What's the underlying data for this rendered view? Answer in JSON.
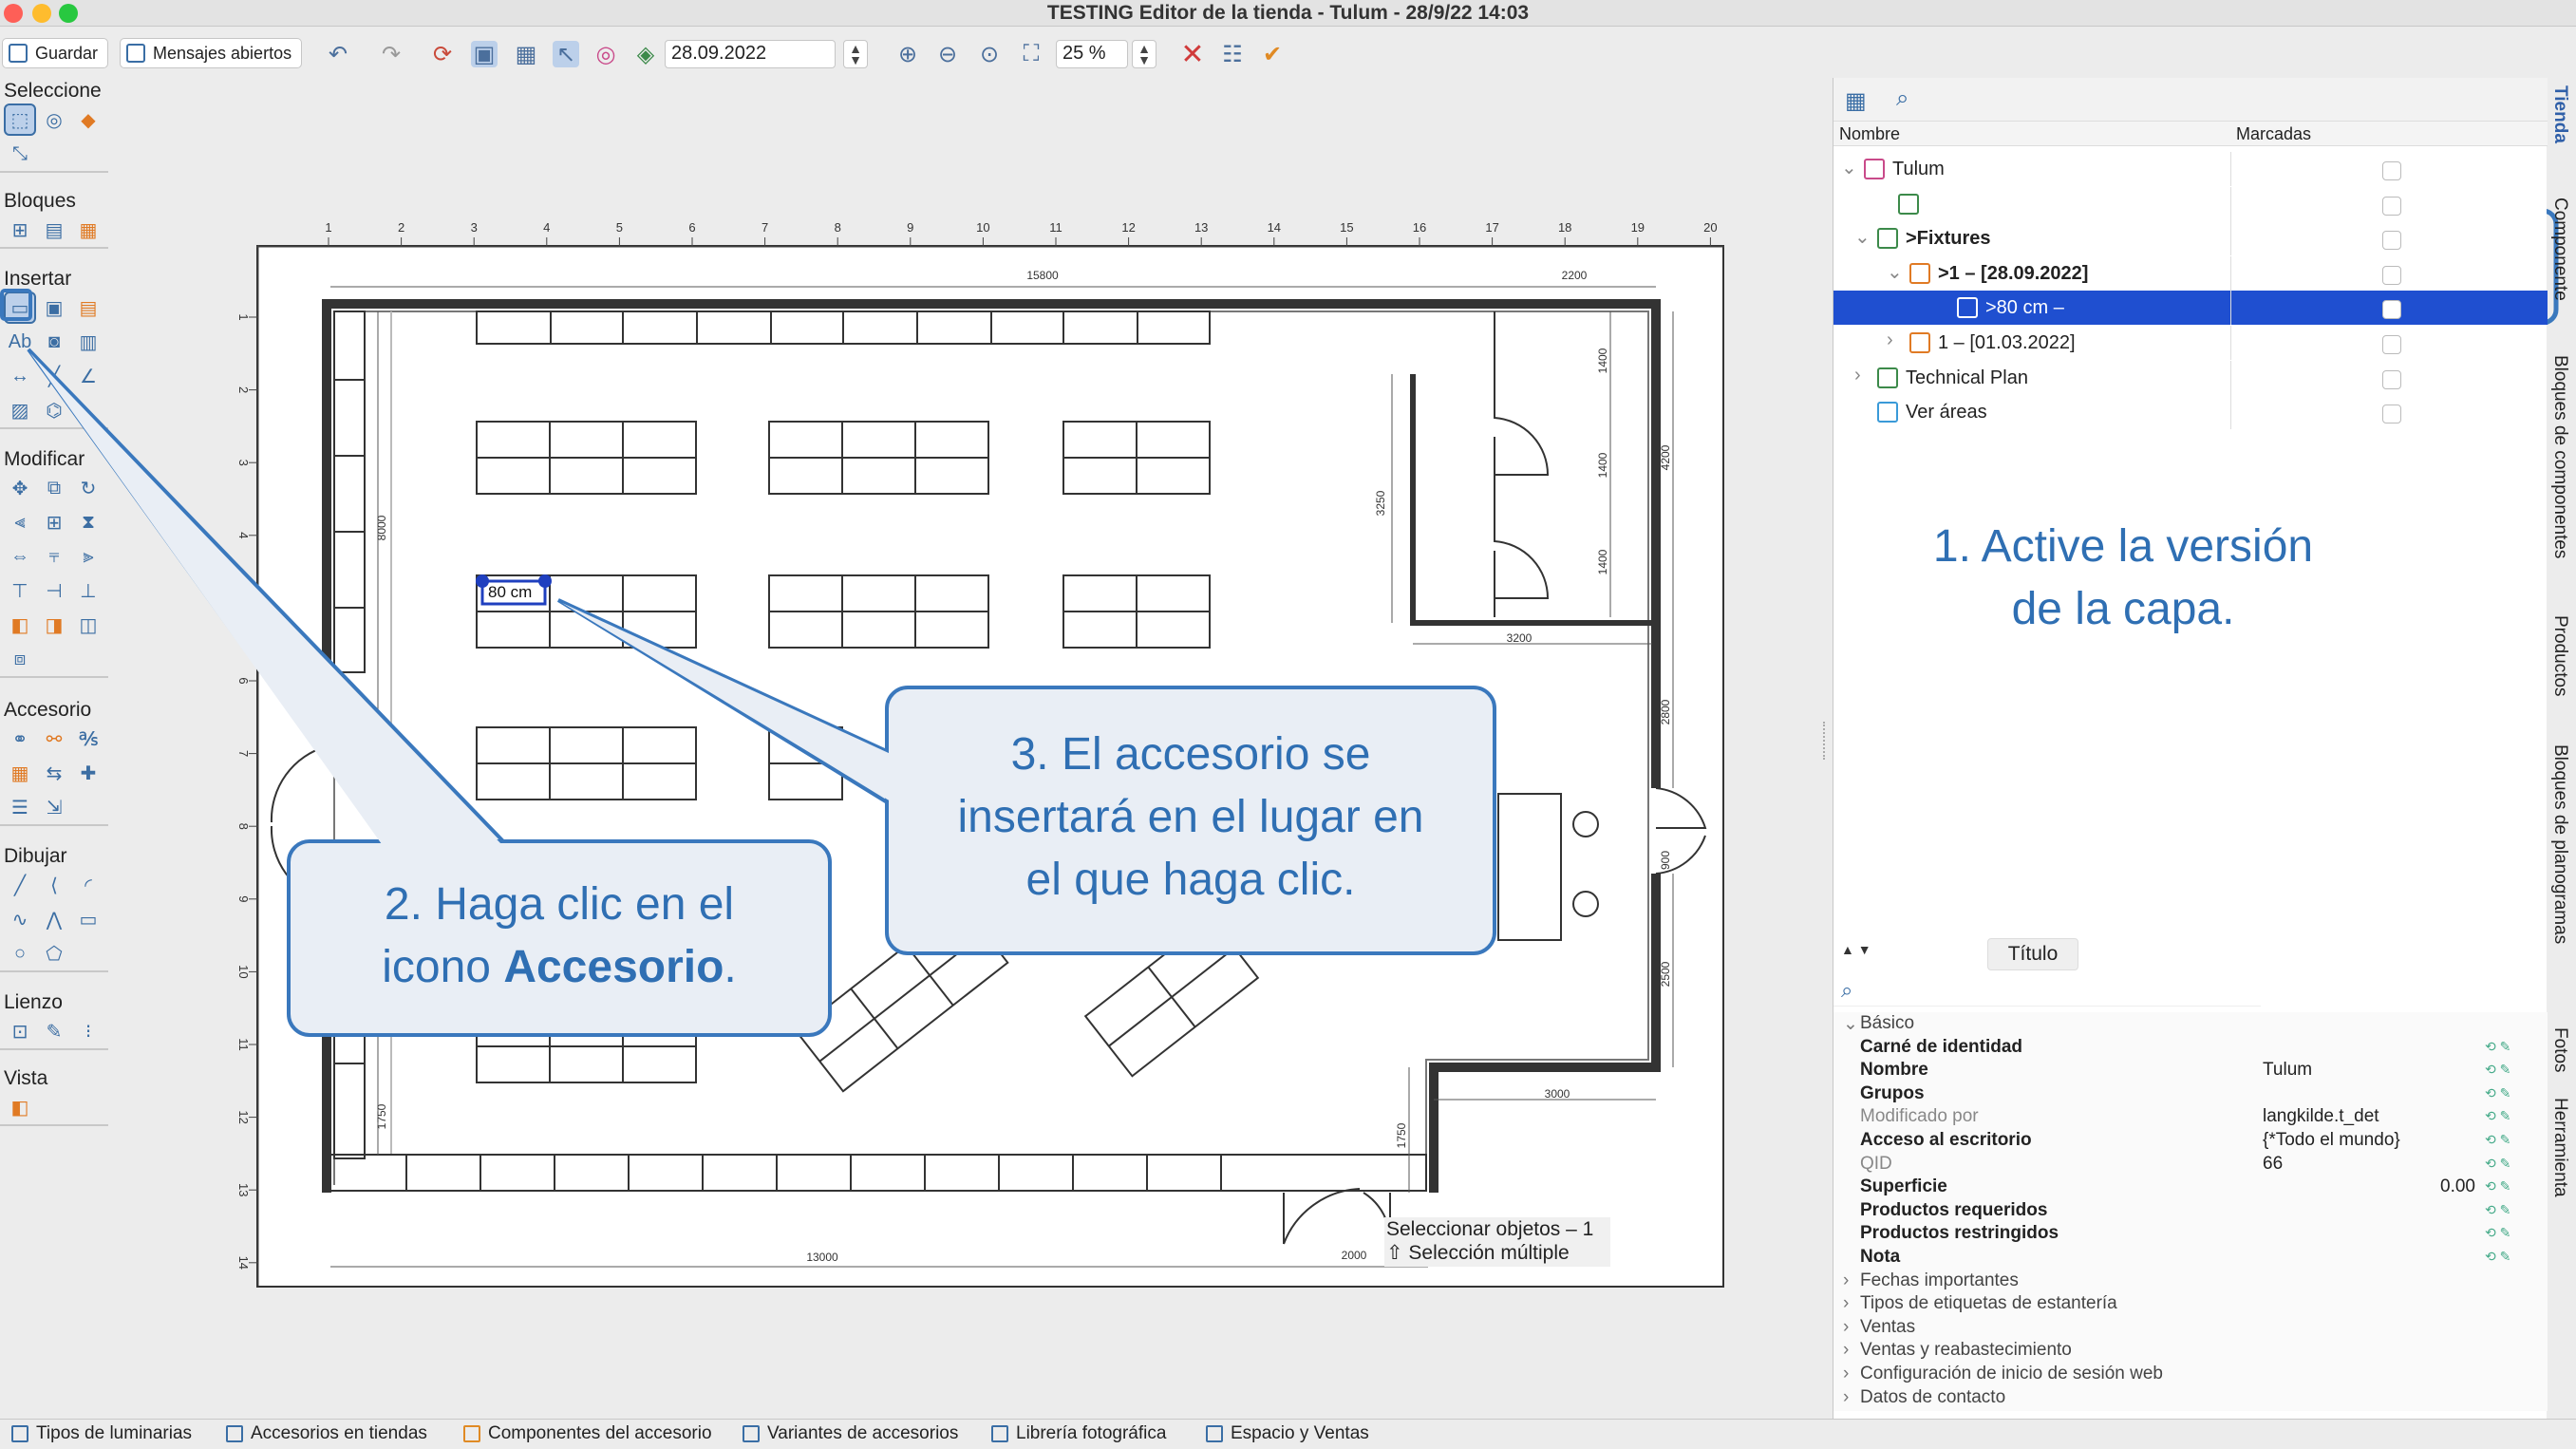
{
  "window": {
    "title": "TESTING Editor de la tienda - Tulum - 28/9/22 14:03"
  },
  "toolbar": {
    "save_label": "Guardar",
    "messages_label": "Mensajes abiertos",
    "date_value": "28.09.2022",
    "zoom_value": "25 %"
  },
  "palette": {
    "groups": [
      "Seleccione",
      "Bloques",
      "Insertar",
      "Modificar",
      "Accesorio",
      "Dibujar",
      "Lienzo",
      "Vista"
    ]
  },
  "canvas": {
    "ruler_top": [
      "1",
      "2",
      "3",
      "4",
      "5",
      "6",
      "7",
      "8",
      "9",
      "10",
      "11",
      "12",
      "13",
      "14",
      "15",
      "16",
      "17",
      "18",
      "19",
      "20"
    ],
    "ruler_left": [
      "1",
      "2",
      "3",
      "4",
      "5",
      "6",
      "7",
      "8",
      "9",
      "10",
      "11",
      "12",
      "13",
      "14"
    ],
    "dimensions": {
      "top_long": "15800",
      "top_right": "2200",
      "bottom_long": "13000",
      "bottom_right": "2000",
      "left_upper": "8000",
      "left_lower": "1750",
      "room_height": "3250",
      "room_width": "3200",
      "right_a": "1400",
      "right_b": "1400",
      "right_c": "1400",
      "right_outer": "4200",
      "right_mid": "2800",
      "right_door": "900",
      "right_low": "2500",
      "bottom_room_width": "3000",
      "bottom_room_height": "1750"
    },
    "selected_label": "80 cm",
    "status": {
      "line1": "Seleccionar objetos – 1",
      "line2": "⇧ Selección múltiple"
    }
  },
  "tree": {
    "headers": {
      "name": "Nombre",
      "marked": "Marcadas"
    },
    "rows": [
      {
        "label": "Tulum"
      },
      {
        "label": ""
      },
      {
        "label": ">Fixtures"
      },
      {
        "label": ">1 – [28.09.2022]"
      },
      {
        "label": ">80 cm –"
      },
      {
        "label": "1 – [01.03.2022]"
      },
      {
        "label": "Technical Plan"
      },
      {
        "label": "Ver áreas"
      }
    ],
    "colors": {
      "selection": "#1f4fd0"
    }
  },
  "properties": {
    "tooltip": "Título",
    "rows": [
      {
        "key": "Básico",
        "value": "",
        "kind": "section"
      },
      {
        "key": "Carné de identidad",
        "value": "",
        "kind": "bold"
      },
      {
        "key": "Nombre",
        "value": "Tulum",
        "kind": "bold"
      },
      {
        "key": "Grupos",
        "value": "",
        "kind": "bold"
      },
      {
        "key": "Modificado por",
        "value": "langkilde.t_det",
        "kind": "dim"
      },
      {
        "key": "Acceso al escritorio",
        "value": "{*Todo el mundo}",
        "kind": "bold"
      },
      {
        "key": "QID",
        "value": "66",
        "kind": "dim"
      },
      {
        "key": "Superficie",
        "value": "0.00",
        "kind": "bold"
      },
      {
        "key": "Productos requeridos",
        "value": "",
        "kind": "bold"
      },
      {
        "key": "Productos restringidos",
        "value": "",
        "kind": "bold"
      },
      {
        "key": "Nota",
        "value": "",
        "kind": "bold"
      },
      {
        "key": "Fechas importantes",
        "value": "",
        "kind": "collapsed"
      },
      {
        "key": "Tipos de etiquetas de estantería",
        "value": "",
        "kind": "collapsed"
      },
      {
        "key": "Ventas",
        "value": "",
        "kind": "collapsed"
      },
      {
        "key": "Ventas y reabastecimiento",
        "value": "",
        "kind": "collapsed"
      },
      {
        "key": "Configuración de inicio de sesión web",
        "value": "",
        "kind": "collapsed"
      },
      {
        "key": "Datos de contacto",
        "value": "",
        "kind": "collapsed"
      }
    ]
  },
  "side_tabs": [
    "Tienda",
    "Componente",
    "Bloques de componentes",
    "Productos",
    "Bloques de planogramas",
    "Fotos",
    "Herramienta"
  ],
  "bottom_tabs": [
    "Tipos de luminarias",
    "Accesorios en tiendas",
    "Componentes del accesorio",
    "Variantes de accesorios",
    "Librería fotográfica",
    "Espacio y Ventas"
  ],
  "callouts": {
    "c1": {
      "line1": "1. Active la versión",
      "line2": "de la capa."
    },
    "c2": {
      "line1": "2. Haga clic en el",
      "line2_prefix": "icono ",
      "line2_bold": "Accesorio",
      "line2_suffix": "."
    },
    "c3": {
      "line1": "3. El accesorio se",
      "line2": "insertará en el lugar en",
      "line3": "el que haga clic."
    },
    "color": "#2f6fb3"
  }
}
